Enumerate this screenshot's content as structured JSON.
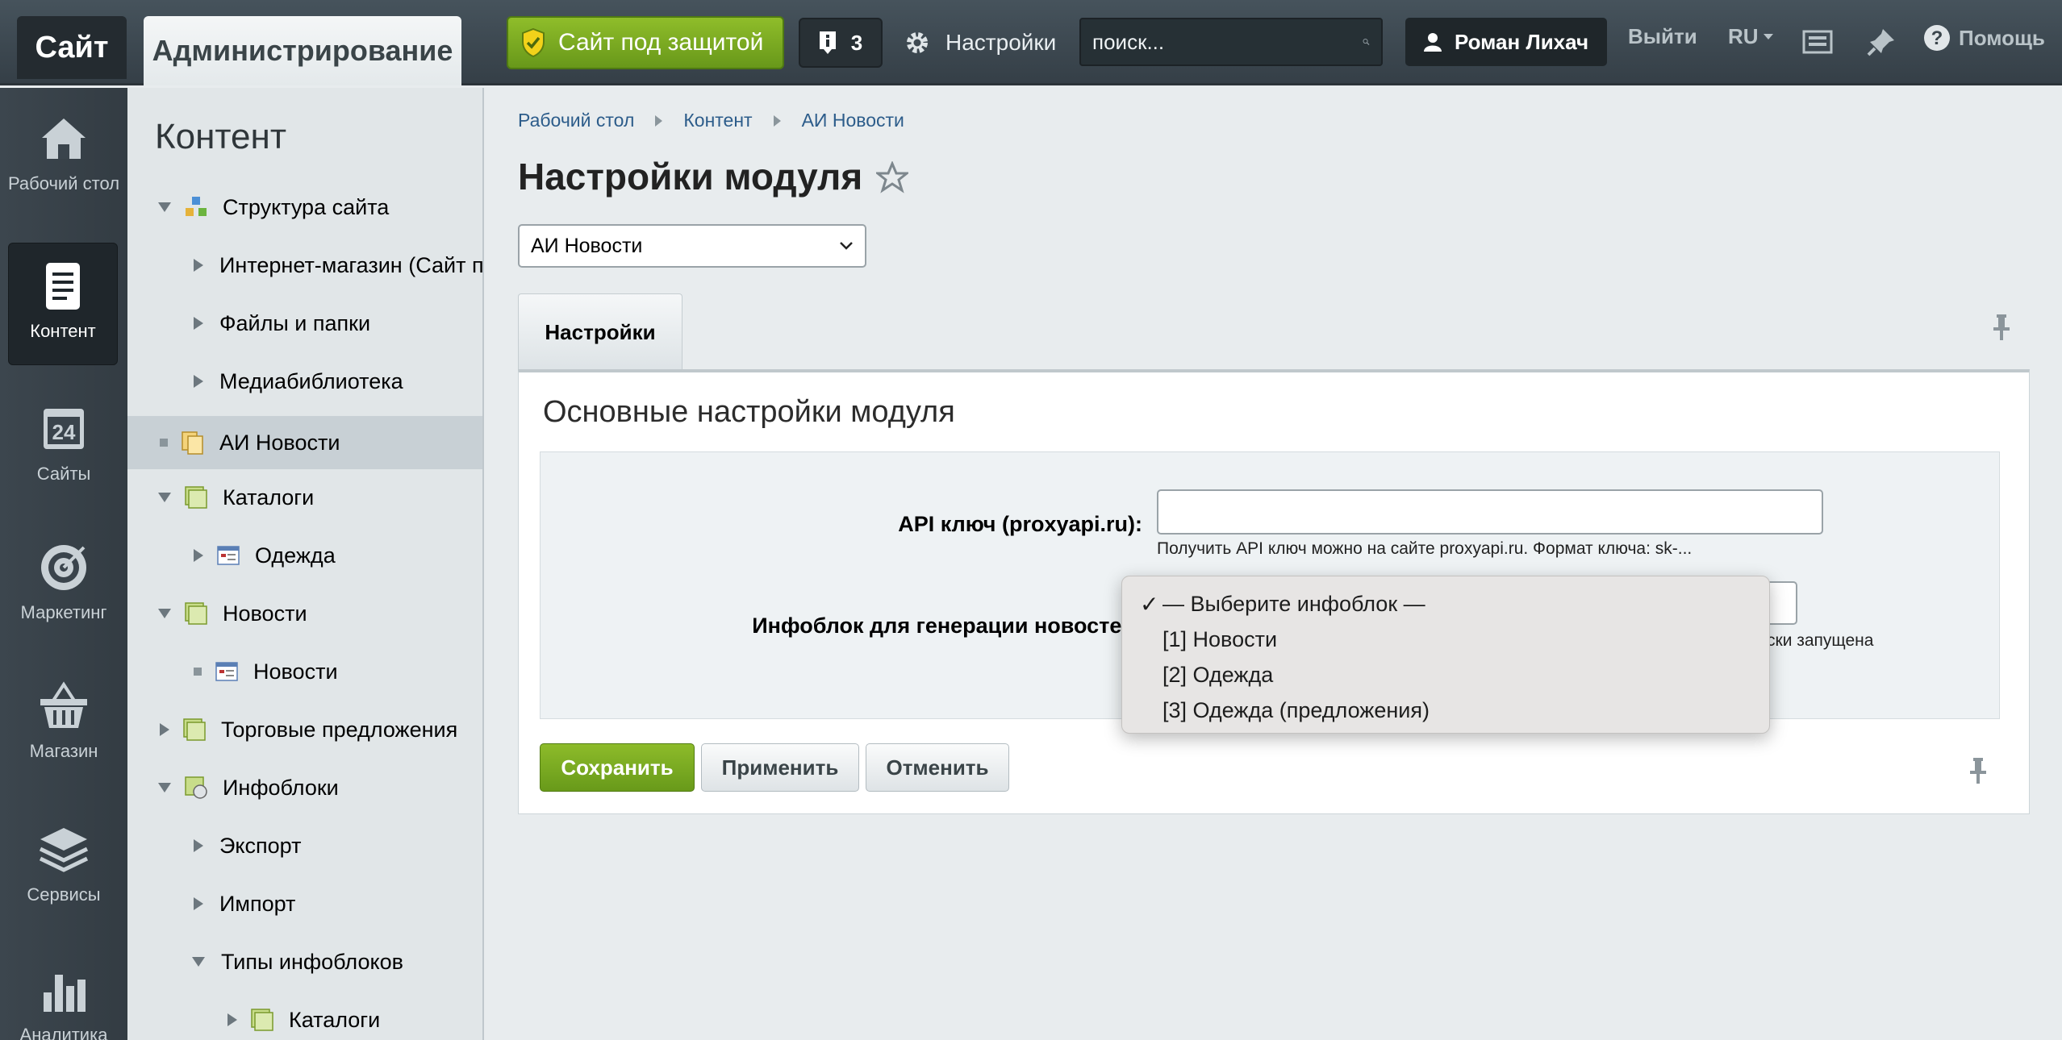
{
  "topbar": {
    "site_tab": "Сайт",
    "admin_tab": "Администрирование",
    "protect_button": "Сайт под защитой",
    "notifications_count": "3",
    "settings_label": "Настройки",
    "search_placeholder": "поиск...",
    "user_name": "Роман Лихач",
    "logout": "Выйти",
    "lang": "RU",
    "help": "Помощь"
  },
  "iconbar": {
    "items": [
      {
        "label": "Рабочий стол",
        "icon": "home-icon"
      },
      {
        "label": "Контент",
        "icon": "document-icon"
      },
      {
        "label": "Сайты",
        "icon": "calendar-24-icon"
      },
      {
        "label": "Маркетинг",
        "icon": "target-icon"
      },
      {
        "label": "Магазин",
        "icon": "basket-icon"
      },
      {
        "label": "Сервисы",
        "icon": "layers-icon"
      },
      {
        "label": "Аналитика",
        "icon": "bar-chart-icon"
      }
    ]
  },
  "menu": {
    "title": "Контент",
    "items": [
      {
        "label": "Структура сайта"
      },
      {
        "label": "Интернет-магазин (Сайт по умолчанию)"
      },
      {
        "label": "Файлы и папки"
      },
      {
        "label": "Медиабиблиотека"
      },
      {
        "label": "АИ Новости"
      },
      {
        "label": "Каталоги"
      },
      {
        "label": "Одежда"
      },
      {
        "label": "Новости"
      },
      {
        "label": "Новости"
      },
      {
        "label": "Торговые предложения"
      },
      {
        "label": "Инфоблоки"
      },
      {
        "label": "Экспорт"
      },
      {
        "label": "Импорт"
      },
      {
        "label": "Типы инфоблоков"
      },
      {
        "label": "Каталоги"
      }
    ]
  },
  "main": {
    "breadcrumb": [
      "Рабочий стол",
      "Контент",
      "АИ Новости"
    ],
    "title": "Настройки модуля",
    "module_select": "АИ Новости",
    "tab": "Настройки",
    "section_title": "Основные настройки модуля",
    "api_label": "API ключ (proxyapi.ru):",
    "api_value": "",
    "api_hint": "Получить API ключ можно на сайте proxyapi.ru. Формат ключа: sk-...",
    "infoblock_label": "Инфоблок для генерации новостей:",
    "infoblock_hint_tail": "ски запущена",
    "buttons": {
      "save": "Сохранить",
      "apply": "Применить",
      "cancel": "Отменить"
    }
  },
  "dropdown": {
    "selected_mark": "✓",
    "options": [
      "— Выберите инфоблок —",
      "[1] Новости",
      "[2] Одежда",
      "[3] Одежда (предложения)"
    ]
  }
}
